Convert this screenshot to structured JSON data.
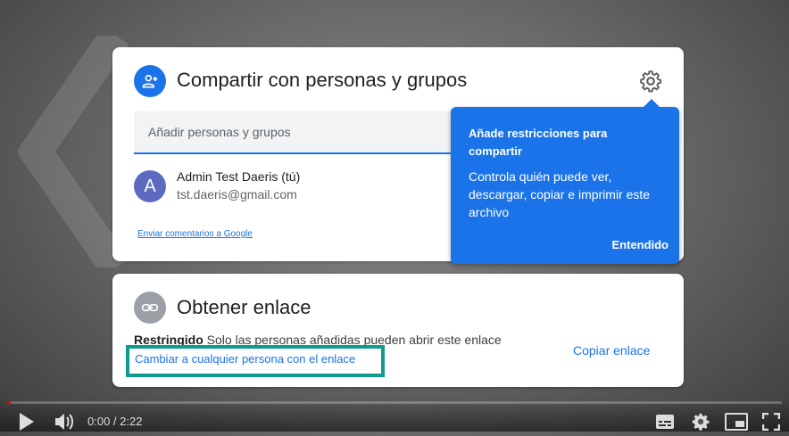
{
  "share": {
    "title": "Compartir con personas y grupos",
    "search_placeholder": "Añadir personas y grupos",
    "user": {
      "avatar_letter": "A",
      "name": "Admin Test Daeris (tú)",
      "email": "tst.daeris@gmail.com"
    },
    "feedback_link": "Enviar comentarios a Google"
  },
  "tooltip": {
    "title": "Añade restricciones para compartir",
    "body": "Controla quién puede ver, descargar, copiar e imprimir este archivo",
    "button": "Entendido"
  },
  "link": {
    "title": "Obtener enlace",
    "restriction_label": "Restringido",
    "restriction_desc": "Solo las personas añadidas pueden abrir este enlace",
    "change_link": "Cambiar a cualquier persona con el enlace",
    "copy_button": "Copiar enlace"
  },
  "player": {
    "time": "0:00 / 2:22",
    "progress": 0.0
  },
  "colors": {
    "accent": "#1a73e8",
    "highlight_border": "#0f9b8e",
    "avatar": "#5c6bc0",
    "link_icon_bg": "#9aa0a6"
  },
  "icons": [
    "add-person-icon",
    "gear-icon",
    "link-icon",
    "play-icon",
    "volume-icon",
    "subtitles-icon",
    "settings-icon",
    "miniplayer-icon",
    "fullscreen-icon"
  ]
}
